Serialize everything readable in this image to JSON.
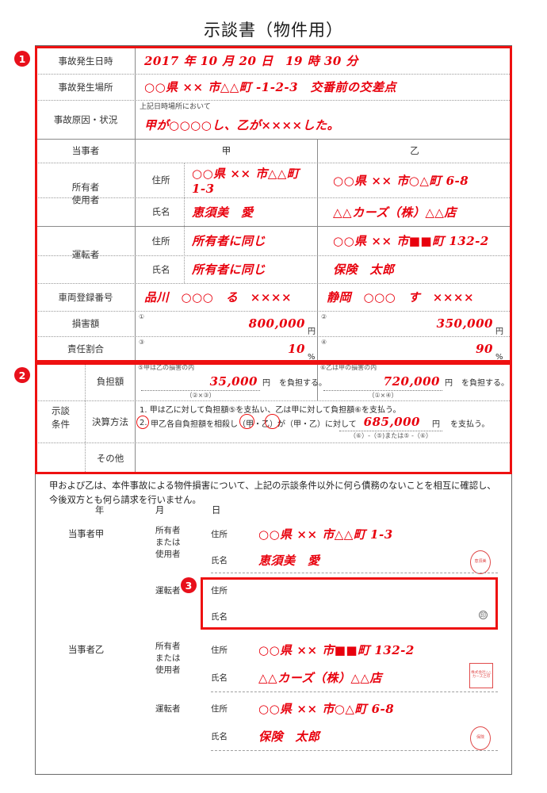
{
  "document": {
    "title": "示談書（物件用）"
  },
  "markers": [
    {
      "id": "1",
      "label": "1"
    },
    {
      "id": "2",
      "label": "2"
    },
    {
      "id": "3",
      "label": "3"
    }
  ],
  "accident": {
    "datetime_label": "事故発生日時",
    "datetime_value": "2017 年 10 月 20 日　19 時 30 分",
    "place_label": "事故発生場所",
    "place_value": "○○県 ×× 市△△町 -1-2-3　交番前の交差点",
    "cause_label": "事故原因・状況",
    "cause_note": "上記日時場所において",
    "cause_value": "甲が○○○○し、乙が××××した。"
  },
  "parties": {
    "header_label": "当事者",
    "col_a": "甲",
    "col_b": "乙",
    "owner_label": "所有者\n使用者",
    "owner_label_line1": "所有者",
    "owner_label_line2": "使用者",
    "driver_label": "運転者",
    "address_label": "住所",
    "name_label": "氏名",
    "owner": {
      "address": {
        "a": "○○県 ×× 市△△町 1-3",
        "b": "○○県 ×× 市○△町 6-8"
      },
      "name": {
        "a": "恵須美　愛",
        "b": "△△カーズ（株）△△店"
      }
    },
    "driver": {
      "address": {
        "a": "所有者に同じ",
        "b": "○○県 ×× 市■■町 132-2"
      },
      "name": {
        "a": "所有者に同じ",
        "b": "保険　太郎"
      }
    },
    "vehicle_label": "車両登録番号",
    "vehicle": {
      "a": "品川　○○○　る　××××",
      "b": "静岡　○○○　す　××××"
    },
    "damage_label": "損害額",
    "damage": {
      "a_no": "①",
      "a_value": "800,000",
      "a_unit": "円",
      "b_no": "②",
      "b_value": "350,000",
      "b_unit": "円"
    },
    "liability_label": "責任割合",
    "liability": {
      "a_no": "③",
      "a_value": "10",
      "a_unit": "%",
      "b_no": "④",
      "b_value": "90",
      "b_unit": "%"
    }
  },
  "settlement": {
    "section_label_line1": "示談",
    "section_label_line2": "条件",
    "burden_label": "負担額",
    "burden": {
      "a_note": "⑤甲は乙の損害の内",
      "a_value": "35,000",
      "a_unit": "円",
      "a_suffix": "を負担する。",
      "a_formula": "（②×③）",
      "b_note": "⑥乙は甲の損害の内",
      "b_value": "720,000",
      "b_unit": "円",
      "b_suffix": "を負担する。",
      "b_formula": "（①×④）"
    },
    "method_label": "決算方法",
    "method_line1": "1. 甲は乙に対して負担額⑤を支払い、乙は甲に対して負担額⑥を支払う。",
    "method_line2_num": "2.",
    "method_line2_a": "甲乙各自負担額を相殺し（甲・乙）が（甲・乙）に対して",
    "method_line2_value": "685,000",
    "method_line2_unit": "円",
    "method_line2_suffix": "を支払う。",
    "method_formula": "（⑥）-（⑤)または⑤ -（⑥）",
    "other_label": "その他"
  },
  "agreement": {
    "text_line1": "甲および乙は、本件事故による物件損害について、上記の示談条件以外に何ら債務のないことを相互に確認し、",
    "text_line2": "今後双方とも何ら請求を行いません。",
    "date": {
      "year": "年",
      "month": "月",
      "day": "日"
    }
  },
  "signatures": {
    "address_label": "住所",
    "name_label": "氏名",
    "owner_label_line1": "所有者",
    "owner_label_line2": "または",
    "owner_label_line3": "使用者",
    "driver_label": "運転者",
    "seal_mark": "印",
    "party_a": {
      "title": "当事者甲",
      "owner_address": "○○県 ×× 市△△町 1-3",
      "owner_name": "恵須美　愛",
      "owner_seal": "恵須美",
      "driver_address": "",
      "driver_name": ""
    },
    "party_b": {
      "title": "当事者乙",
      "owner_address": "○○県 ×× 市■■町 132-2",
      "owner_name": "△△カーズ（株）△△店",
      "owner_seal": "株式会社△△カーズ之印",
      "driver_address": "○○県 ×× 市○△町 6-8",
      "driver_name": "保険　太郎",
      "driver_seal": "保険"
    }
  },
  "colors": {
    "handwriting": "#e8000d",
    "marker": "#e8101b",
    "highlight_box": "#ee1111",
    "rule": "#8a8a8a"
  }
}
